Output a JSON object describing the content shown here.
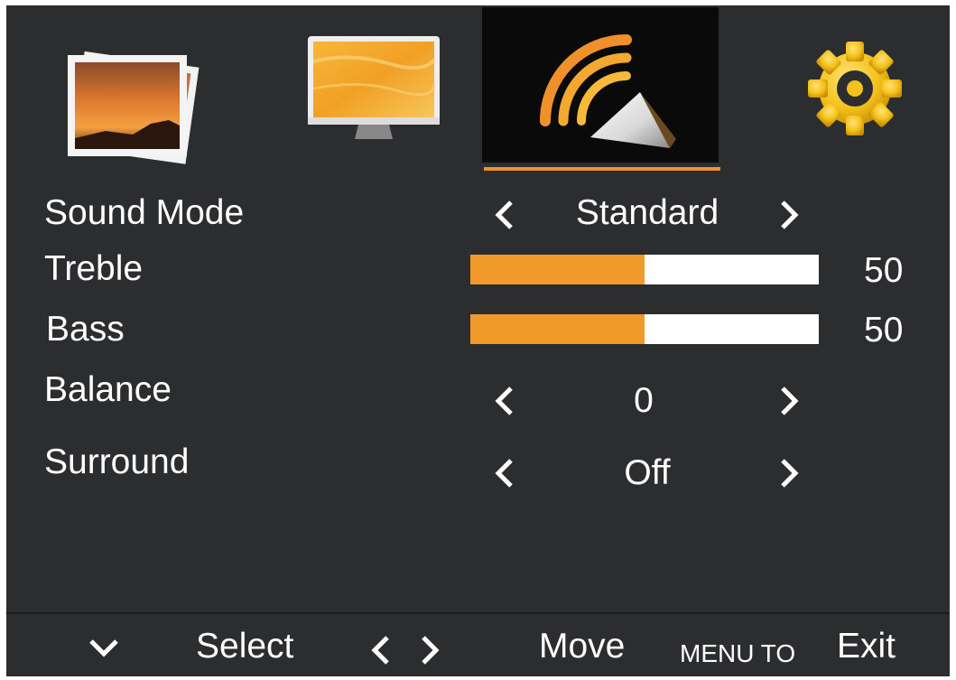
{
  "tabs": [
    {
      "name": "picture",
      "icon": "photos-icon"
    },
    {
      "name": "display",
      "icon": "monitor-icon"
    },
    {
      "name": "sound",
      "icon": "sound-icon",
      "active": true
    },
    {
      "name": "setup",
      "icon": "gear-icon"
    }
  ],
  "colors": {
    "accent": "#f0902a",
    "background": "#2b2d2f",
    "active_tab_bg": "#0a0a0a"
  },
  "menu": {
    "sound_mode": {
      "label": "Sound Mode",
      "value": "Standard"
    },
    "treble": {
      "label": "Treble",
      "value": "50",
      "level": 0.5
    },
    "bass": {
      "label": "Bass",
      "value": "50",
      "level": 0.5
    },
    "balance": {
      "label": "Balance",
      "value": "0"
    },
    "surround": {
      "label": "Surround",
      "value": "Off"
    }
  },
  "footer": {
    "select_label": "Select",
    "move_label": "Move",
    "menu_to_label": "MENU TO",
    "exit_label": "Exit"
  }
}
